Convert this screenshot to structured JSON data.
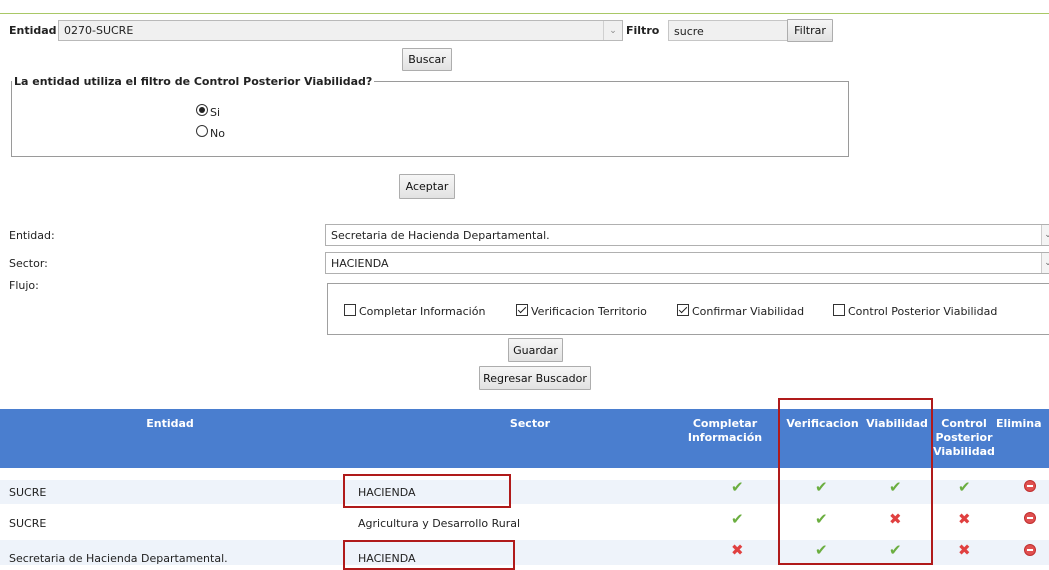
{
  "top": {
    "entidad_label": "Entidad",
    "entidad_value": "0270-SUCRE",
    "filtro_label": "Filtro",
    "filtro_value": "sucre",
    "filtrar_button": "Filtrar",
    "buscar_button": "Buscar"
  },
  "question": {
    "legend": "La entidad utiliza el filtro de Control Posterior Viabilidad?",
    "opt_si": "Si",
    "opt_no": "No",
    "selected": "Si",
    "aceptar_button": "Aceptar"
  },
  "form": {
    "entidad_label": "Entidad:",
    "entidad_value": "Secretaria de Hacienda Departamental.",
    "sector_label": "Sector:",
    "sector_value": "HACIENDA",
    "flujo_label": "Flujo:",
    "checks": [
      {
        "label": "Completar Información",
        "checked": false
      },
      {
        "label": "Verificacion Territorio",
        "checked": true
      },
      {
        "label": "Confirmar Viabilidad",
        "checked": true
      },
      {
        "label": "Control Posterior Viabilidad",
        "checked": false
      }
    ],
    "guardar_button": "Guardar",
    "regresar_button": "Regresar Buscador"
  },
  "table": {
    "headers": {
      "entidad": "Entidad",
      "sector": "Sector",
      "completar_1": "Completar",
      "completar_2": "Información",
      "verificacion": "Verificacion",
      "viabilidad": "Viabilidad",
      "control_1": "Control",
      "control_2": "Posterior",
      "control_3": "Viabilidad",
      "eliminar": "Elimina"
    },
    "rows": [
      {
        "entidad": "SUCRE",
        "sector": "HACIENDA",
        "completar": "check",
        "verificacion": "check",
        "viabilidad": "check",
        "control": "check"
      },
      {
        "entidad": "SUCRE",
        "sector": "Agricultura y Desarrollo Rural",
        "completar": "check",
        "verificacion": "check",
        "viabilidad": "cross",
        "control": "cross"
      },
      {
        "entidad": "Secretaria de Hacienda Departamental.",
        "sector": "HACIENDA",
        "completar": "cross",
        "verificacion": "check",
        "viabilidad": "check",
        "control": "cross"
      }
    ]
  },
  "colors": {
    "header_bg": "#4a7ecf",
    "row_alt_bg": "#eef3fa",
    "check": "#6bae40",
    "cross": "#e04040",
    "highlight": "#b01a1a"
  }
}
